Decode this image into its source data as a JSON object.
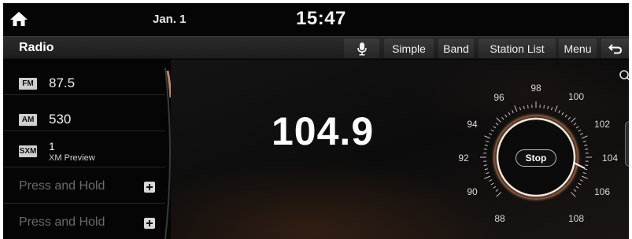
{
  "status": {
    "date": "Jan. 1",
    "time": "15:47"
  },
  "toolbar": {
    "title": "Radio",
    "simple_label": "Simple",
    "band_label": "Band",
    "station_list_label": "Station List",
    "menu_label": "Menu"
  },
  "list": {
    "items": [
      {
        "badge": "FM",
        "frequency": "87.5",
        "subtitle": ""
      },
      {
        "badge": "AM",
        "frequency": "530",
        "subtitle": ""
      },
      {
        "badge": "SXM",
        "frequency": "1",
        "subtitle": "XM Preview"
      }
    ],
    "empty_slots": [
      {
        "label": "Press and Hold"
      },
      {
        "label": "Press and Hold"
      }
    ]
  },
  "main": {
    "frequency": "104.9",
    "stop_label": "Stop"
  },
  "dial": {
    "labels": [
      "88",
      "90",
      "92",
      "94",
      "96",
      "98",
      "100",
      "102",
      "104",
      "106",
      "108"
    ]
  },
  "colors": {
    "background": "#050505",
    "accent": "#c9825a",
    "text": "#f1f1f1",
    "muted": "#6a6a6a"
  },
  "icons": {
    "home": "home-icon",
    "mic": "mic-icon",
    "back": "back-icon",
    "plus": "plus-icon",
    "search": "search-icon"
  }
}
